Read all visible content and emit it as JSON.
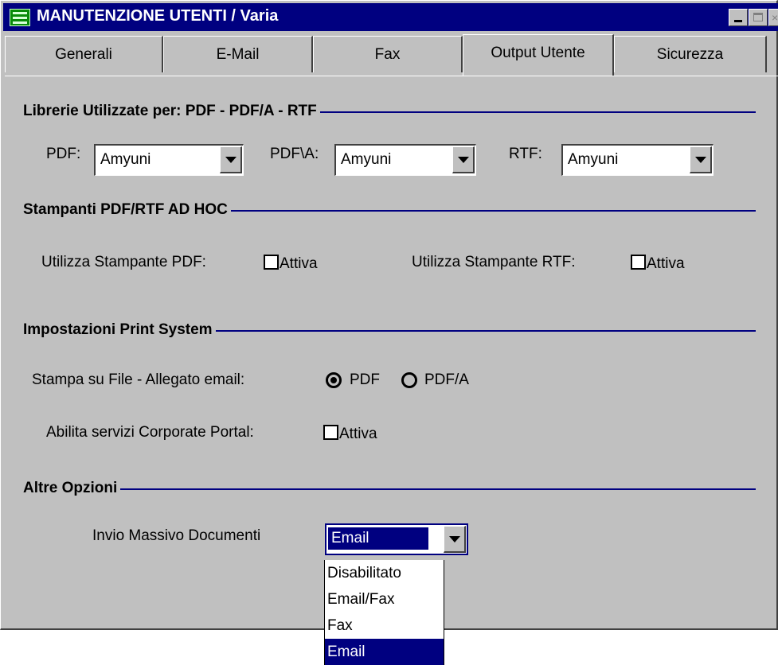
{
  "window": {
    "title": "MANUTENZIONE UTENTI / Varia"
  },
  "tabs": [
    "Generali",
    "E-Mail",
    "Fax",
    "Output Utente",
    "Sicurezza"
  ],
  "active_tab": "Output Utente",
  "sections": {
    "librerie": {
      "title": "Librerie Utilizzate per: PDF - PDF/A - RTF",
      "pdf_label": "PDF:",
      "pdf_value": "Amyuni",
      "pdfa_label": "PDF\\A:",
      "pdfa_value": "Amyuni",
      "rtf_label": "RTF:",
      "rtf_value": "Amyuni"
    },
    "stampanti": {
      "title": "Stampanti PDF/RTF AD HOC",
      "pdf_label": "Utilizza Stampante PDF:",
      "pdf_check": "Attiva",
      "pdf_checked": false,
      "rtf_label": "Utilizza Stampante RTF:",
      "rtf_check": "Attiva",
      "rtf_checked": false
    },
    "print_system": {
      "title": "Impostazioni Print System",
      "stampa_label": "Stampa su File - Allegato email:",
      "radio_pdf": "PDF",
      "radio_pdfa": "PDF/A",
      "selected": "PDF",
      "portal_label": "Abilita servizi Corporate Portal:",
      "portal_check": "Attiva",
      "portal_checked": false
    },
    "altre": {
      "title": "Altre Opzioni",
      "invio_label": "Invio Massivo Documenti",
      "invio_value": "Email",
      "invio_options": [
        "Disabilitato",
        "Email/Fax",
        "Fax",
        "Email"
      ],
      "invio_highlight": "Email"
    }
  },
  "colors": {
    "titlebar": "#000080",
    "face": "#c0c0c0",
    "selection": "#000080",
    "section_line": "#000080"
  }
}
